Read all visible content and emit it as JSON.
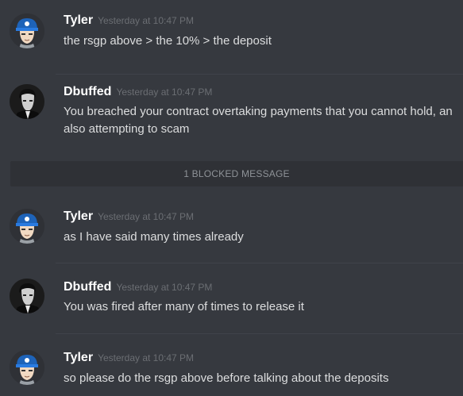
{
  "messages": [
    {
      "author": "Tyler",
      "timestamp": "Yesterday at 10:47 PM",
      "lines": [
        "the rsgp above > the 10% > the deposit"
      ],
      "avatar": "tyler-avatar"
    },
    {
      "author": "Dbuffed",
      "timestamp": "Yesterday at 10:47 PM",
      "lines": [
        "You breached your contract overtaking payments that you cannot hold, an",
        "also attempting to scam"
      ],
      "avatar": "dbuffed-avatar"
    },
    {
      "author": "Tyler",
      "timestamp": "Yesterday at 10:47 PM",
      "lines": [
        "as I have said many times already"
      ],
      "avatar": "tyler-avatar"
    },
    {
      "author": "Dbuffed",
      "timestamp": "Yesterday at 10:47 PM",
      "lines": [
        "You was fired after many of times to release it"
      ],
      "avatar": "dbuffed-avatar"
    },
    {
      "author": "Tyler",
      "timestamp": "Yesterday at 10:47 PM",
      "lines": [
        "so please do the rsgp above before talking about the deposits"
      ],
      "avatar": "tyler-avatar"
    }
  ],
  "blocked_notice": "1 BLOCKED MESSAGE",
  "colors": {
    "background": "#36393f",
    "username": "#ffffff",
    "timestamp": "#6b6e73",
    "text": "#dcddde",
    "blocked_bar": "#2f3136"
  }
}
